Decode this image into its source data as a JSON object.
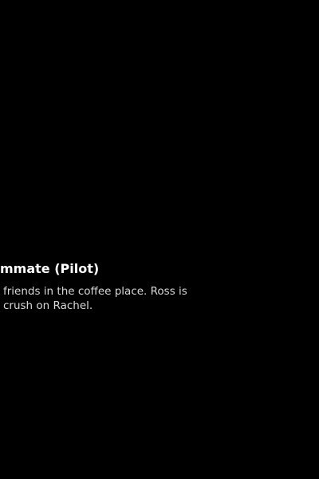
{
  "episode": {
    "title": "mmate (Pilot)",
    "synopsis_lines": [
      "friends in the coffee place. Ross is",
      "crush on Rachel."
    ]
  },
  "colors": {
    "background": "#000000",
    "title": "#ffffff",
    "synopsis": "#d8d8d8"
  }
}
